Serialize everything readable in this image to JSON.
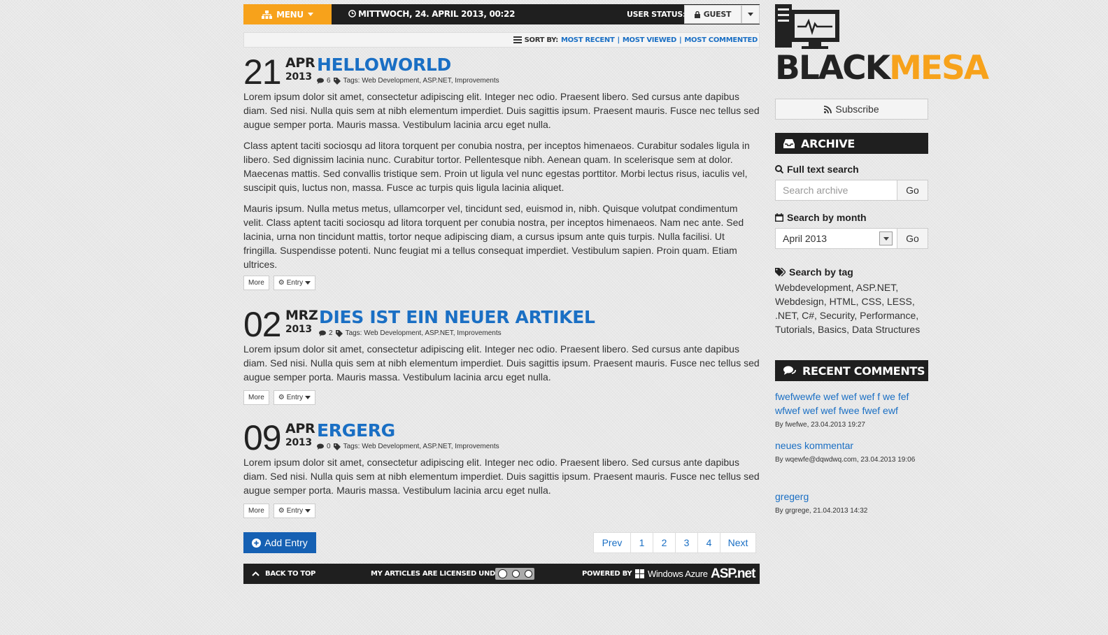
{
  "topbar": {
    "menu_label": "MENU",
    "datetime": "MITTWOCH, 24. APRIL 2013, 00:22",
    "user_status_label": "USER STATUS:",
    "user_label": "GUEST"
  },
  "sort": {
    "label": "SORT BY:",
    "options": [
      "MOST RECENT",
      "MOST VIEWED",
      "MOST COMMENTED"
    ]
  },
  "posts": [
    {
      "day": "21",
      "month": "APR",
      "year": "2013",
      "title": "HELLOWORLD",
      "comments": "6",
      "tags": "Tags: Web Development, ASP.NET, Improvements",
      "paragraphs": [
        "Lorem ipsum dolor sit amet, consectetur adipiscing elit. Integer nec odio. Praesent libero. Sed cursus ante dapibus diam. Sed nisi. Nulla quis sem at nibh elementum imperdiet. Duis sagittis ipsum. Praesent mauris. Fusce nec tellus sed augue semper porta. Mauris massa. Vestibulum lacinia arcu eget nulla.",
        "Class aptent taciti sociosqu ad litora torquent per conubia nostra, per inceptos himenaeos. Curabitur sodales ligula in libero. Sed dignissim lacinia nunc. Curabitur tortor. Pellentesque nibh. Aenean quam. In scelerisque sem at dolor. Maecenas mattis. Sed convallis tristique sem. Proin ut ligula vel nunc egestas porttitor. Morbi lectus risus, iaculis vel, suscipit quis, luctus non, massa. Fusce ac turpis quis ligula lacinia aliquet.",
        "Mauris ipsum. Nulla metus metus, ullamcorper vel, tincidunt sed, euismod in, nibh. Quisque volutpat condimentum velit. Class aptent taciti sociosqu ad litora torquent per conubia nostra, per inceptos himenaeos. Nam nec ante. Sed lacinia, urna non tincidunt mattis, tortor neque adipiscing diam, a cursus ipsum ante quis turpis. Nulla facilisi. Ut fringilla. Suspendisse potenti. Nunc feugiat mi a tellus consequat imperdiet. Vestibulum sapien. Proin quam. Etiam ultrices."
      ],
      "more_label": "More",
      "entry_label": "Entry"
    },
    {
      "day": "02",
      "month": "MRZ",
      "year": "2013",
      "title": "DIES IST EIN NEUER ARTIKEL",
      "comments": "2",
      "tags": "Tags: Web Development, ASP.NET, Improvements",
      "paragraphs": [
        "Lorem ipsum dolor sit amet, consectetur adipiscing elit. Integer nec odio. Praesent libero. Sed cursus ante dapibus diam. Sed nisi. Nulla quis sem at nibh elementum imperdiet. Duis sagittis ipsum. Praesent mauris. Fusce nec tellus sed augue semper porta. Mauris massa. Vestibulum lacinia arcu eget nulla."
      ],
      "more_label": "More",
      "entry_label": "Entry"
    },
    {
      "day": "09",
      "month": "APR",
      "year": "2013",
      "title": "ERGERG",
      "comments": "0",
      "tags": "Tags: Web Development, ASP.NET, Improvements",
      "paragraphs": [
        "Lorem ipsum dolor sit amet, consectetur adipiscing elit. Integer nec odio. Praesent libero. Sed cursus ante dapibus diam. Sed nisi. Nulla quis sem at nibh elementum imperdiet. Duis sagittis ipsum. Praesent mauris. Fusce nec tellus sed augue semper porta. Mauris massa. Vestibulum lacinia arcu eget nulla."
      ],
      "more_label": "More",
      "entry_label": "Entry"
    }
  ],
  "add_entry_label": "Add Entry",
  "pagination": {
    "prev": "Prev",
    "pages": [
      "1",
      "2",
      "3",
      "4"
    ],
    "next": "Next"
  },
  "footer": {
    "back_to_top": "BACK TO TOP",
    "license_text": "MY ARTICLES ARE LICENSED UNDER",
    "powered_by": "POWERED BY",
    "azure": "Windows Azure",
    "aspnet": "ASP.net"
  },
  "sidebar": {
    "logo_black": "BLACK",
    "logo_orange": "MESA",
    "subscribe_label": "Subscribe",
    "archive_title": "ARCHIVE",
    "fulltext_label": "Full text search",
    "search_placeholder": "Search archive",
    "go_label": "Go",
    "month_label": "Search by month",
    "month_value": "April 2013",
    "tag_label": "Search by tag",
    "tags": "Webdevelopment, ASP.NET, Webdesign, HTML, CSS, LESS, .NET, C#, Security, Performance, Tutorials, Basics, Data Structures",
    "recent_title": "RECENT COMMENTS",
    "comments": [
      {
        "text": "fwefwewfe wef wef wef f we fef wfwef wef wef fwee fwef ewf",
        "by": "By fwefwe, 23.04.2013 19:27"
      },
      {
        "text": "neues kommentar",
        "by": "By wqewfe@dqwdwq.com, 23.04.2013 19:06"
      },
      {
        "text": "gregerg",
        "by": "By grgrege, 21.04.2013 14:32"
      }
    ]
  },
  "colors": {
    "accent": "#f7a21b",
    "link": "#1a6fc4",
    "dark": "#1f1f1f",
    "primary_button": "#1560b3"
  }
}
